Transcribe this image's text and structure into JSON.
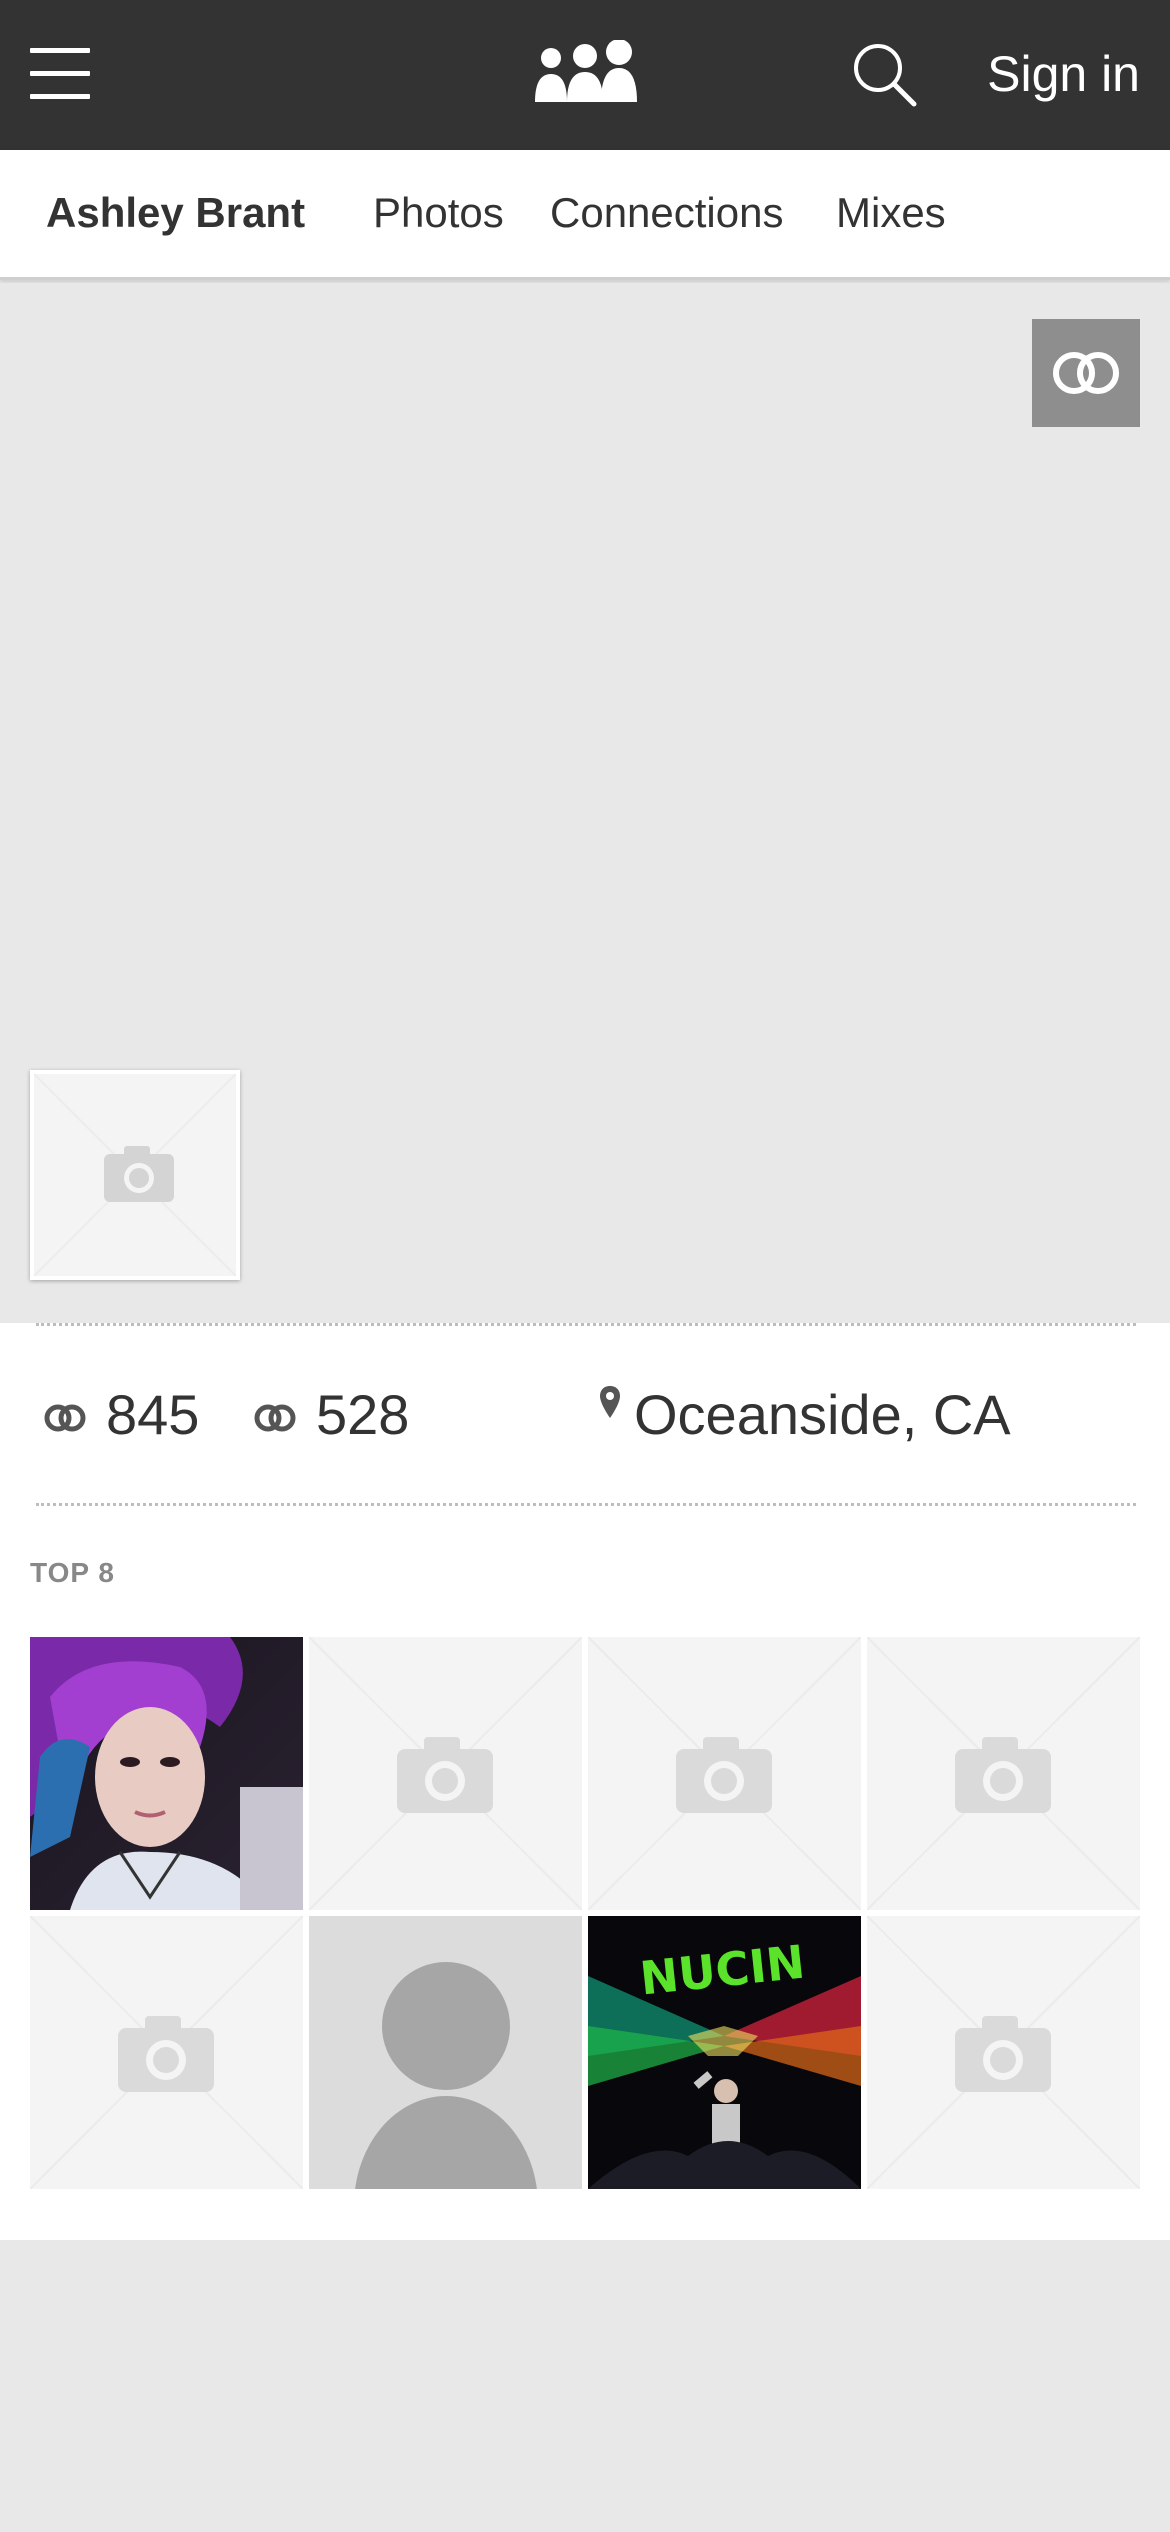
{
  "header": {
    "menu_icon": "hamburger-menu-icon",
    "logo_icon": "people-group-logo-icon",
    "search_icon": "search-icon",
    "signin_label": "Sign in",
    "background_color": "#333333"
  },
  "profile_nav": {
    "name": "Ashley Brant",
    "tabs": [
      {
        "label": "Photos"
      },
      {
        "label": "Connections"
      },
      {
        "label": "Mixes"
      }
    ]
  },
  "cover": {
    "connect_icon": "connect-rings-icon",
    "avatar_icon": "camera-placeholder-icon"
  },
  "stats": {
    "connections_a": "845",
    "connections_b": "528",
    "location": "Oceanside, CA",
    "icons": [
      "rings-icon",
      "rings-icon",
      "location-pin-icon"
    ]
  },
  "top8": {
    "label": "TOP 8",
    "tiles": [
      {
        "kind": "photo",
        "icon": "user-photo"
      },
      {
        "kind": "placeholder",
        "icon": "camera-placeholder-icon"
      },
      {
        "kind": "placeholder",
        "icon": "camera-placeholder-icon"
      },
      {
        "kind": "placeholder",
        "icon": "camera-placeholder-icon"
      },
      {
        "kind": "placeholder",
        "icon": "camera-placeholder-icon"
      },
      {
        "kind": "default-avatar",
        "icon": "default-user-icon"
      },
      {
        "kind": "photo",
        "icon": "user-photo"
      },
      {
        "kind": "placeholder",
        "icon": "camera-placeholder-icon"
      }
    ]
  }
}
